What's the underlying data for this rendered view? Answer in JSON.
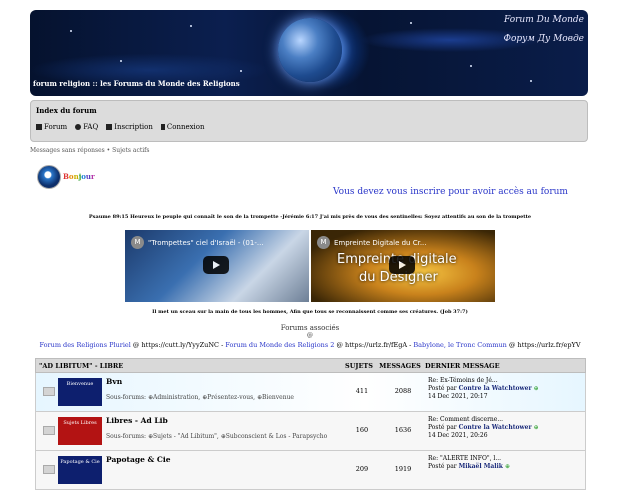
{
  "banner": {
    "title_right": "Forum Du Monde",
    "title_right2": "Форум Ду Мовде",
    "caption": "forum religion :: les Forums du Monde des Religions"
  },
  "nav": {
    "index": "Index du forum",
    "links": [
      "Forum",
      "FAQ",
      "Inscription",
      "Connexion"
    ]
  },
  "sub_links": "Messages sans réponses • Sujets actifs",
  "bonjour": [
    "B",
    "o",
    "n",
    "j",
    "o",
    "u",
    "r"
  ],
  "inscrire": "Vous devez vous inscrire pour avoir accès au forum",
  "psaume": "Psaume 89:15 Heureux le peuple qui connaît le son de la trompette -Jérémie 6:17 J'ai mis près de vous des sentinelles: Soyez attentifs au son de la trompette",
  "videos": [
    {
      "letter": "M",
      "title": "\"Trompettes\" ciel d'Israël - (01-..."
    },
    {
      "letter": "M",
      "title": "Empreinte Digitale du Cr...",
      "big1": "Empreinte digitale",
      "big2": "du Designer"
    }
  ],
  "scean": "Il met un sceau sur la main de tous les hommes, Afin que tous se reconnaissent comme ses créatures. (Job 37:7)",
  "assoc": {
    "title": "Forums associés",
    "at": "@"
  },
  "partners": {
    "p1": "Forum des Religions Pluriel",
    "t1": " @ https://cutt.ly/YyyZuNC - ",
    "p2": "Forum du Monde des Religions 2",
    "t2": " @ https://urlz.fr/fEgA - ",
    "p3": "Babylone, le Tronc Commun",
    "t3": " @ https://urlz.fr/epYV"
  },
  "table": {
    "headers": [
      "\"AD LIBITUM\" - LIBRE",
      "SUJETS",
      "MESSAGES",
      "DERNIER MESSAGE"
    ],
    "rows": [
      {
        "thumb": "Bienvenue",
        "name": "Bvn",
        "subforums": "Sous-forums: ⊕Administration, ⊕Présentez-vous, ⊕Bienvenue",
        "sujets": "411",
        "messages": "2088",
        "last_title": "Re: Ex-Témoins de Jé...",
        "by": "Posté par ",
        "author": "Contre la Watchtower",
        "date": "14 Dec 2021, 20:17"
      },
      {
        "thumb": "Sujets Libres",
        "name": "Libres - Ad Lib",
        "subforums": "Sous-forums: ⊕Sujets - \"Ad Libitum\", ⊕Subconscient & Los - Parapsycho",
        "sujets": "160",
        "messages": "1636",
        "last_title": "Re: Comment discerne...",
        "by": "Posté par ",
        "author": "Contre la Watchtower",
        "date": "14 Dec 2021, 20:26"
      },
      {
        "thumb": "Papotage & Cie",
        "name": "Papotage & Cie",
        "subforums": "",
        "sujets": "209",
        "messages": "1919",
        "last_title": "Re: \"ALERTE INFO\", l...",
        "by": "Posté par ",
        "author": "Mikaël Malik",
        "date": ""
      }
    ]
  }
}
